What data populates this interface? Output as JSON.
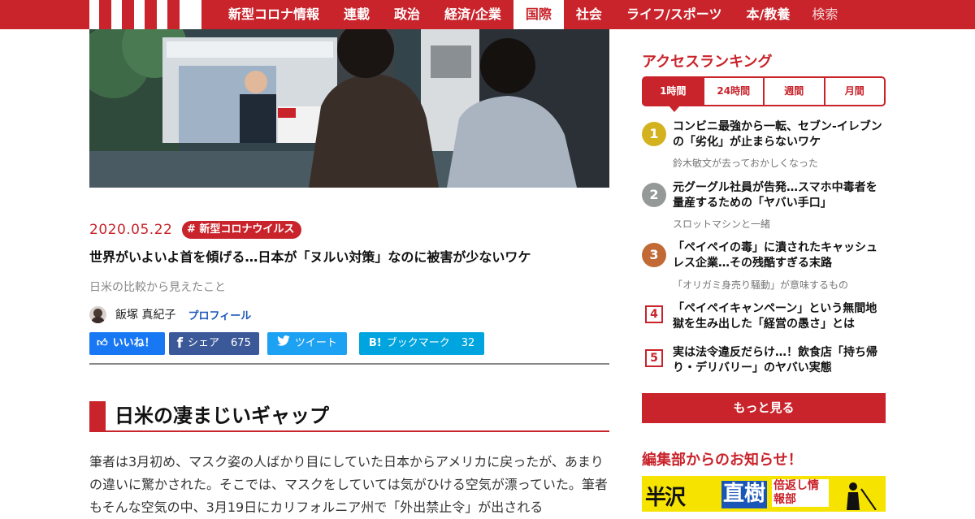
{
  "nav": {
    "items": [
      {
        "label": "新型コロナ情報",
        "active": false
      },
      {
        "label": "連載",
        "active": false
      },
      {
        "label": "政治",
        "active": false
      },
      {
        "label": "経済/企業",
        "active": false
      },
      {
        "label": "国際",
        "active": true
      },
      {
        "label": "社会",
        "active": false
      },
      {
        "label": "ライフ/スポーツ",
        "active": false
      },
      {
        "label": "本/教養",
        "active": false
      }
    ],
    "search_label": "検索"
  },
  "article": {
    "date": "2020.05.22",
    "tag": "# 新型コロナウイルス",
    "title": "世界がいよいよ首を傾げる…日本が「ヌルい対策」なのに被害が少ないワケ",
    "subtitle": "日米の比較から見えたこと",
    "author_name": "飯塚 真紀子",
    "profile_label": "プロフィール",
    "share": {
      "like_label": "いいね！",
      "facebook_label": "シェア",
      "facebook_count": "675",
      "twitter_label": "ツイート",
      "hatena_label": "ブックマーク",
      "hatena_count": "32"
    },
    "heading": "日米の凄まじいギャップ",
    "body": "筆者は3月初め、マスク姿の人ばかり目にしていた日本からアメリカに戻ったが、あまりの違いに驚かされた。そこでは、マスクをしていては気がひける空気が漂っていた。筆者もそんな空気の中、3月19日にカリフォルニア州で「外出禁止令」が出される"
  },
  "ranking": {
    "title": "アクセスランキング",
    "tabs": [
      "1時間",
      "24時間",
      "週間",
      "月間"
    ],
    "active_tab": 0,
    "items": [
      {
        "rank": "1",
        "title": "コンビニ最強から一転、セブン-イレブンの「劣化」が止まらないワケ",
        "sub": "鈴木敏文が去っておかしくなった",
        "badge_color": "#d4b21f"
      },
      {
        "rank": "2",
        "title": "元グーグル社員が告発…スマホ中毒者を量産するための「ヤバい手口」",
        "sub": "スロットマシンと一緒",
        "badge_color": "#959a98"
      },
      {
        "rank": "3",
        "title": "「ペイペイの毒」に潰されたキャッシュレス企業…その残酷すぎる末路",
        "sub": "「オリガミ身売り騒動」が意味するもの",
        "badge_color": "#c16a35"
      },
      {
        "rank": "4",
        "title": "「ペイペイキャンペーン」という無間地獄を生み出した「経営の愚さ」とは",
        "sub": ""
      },
      {
        "rank": "5",
        "title": "実は法令違反だらけ…！飲食店「持ち帰り・デリバリー」のヤバい実態",
        "sub": ""
      }
    ],
    "more_label": "もっと見る"
  },
  "notice": {
    "title": "編集部からのお知らせ！",
    "banner": {
      "line1": "半沢",
      "line2": "直樹",
      "line3": "倍返し情報部"
    }
  },
  "colors": {
    "brand": "#c9232b",
    "link": "#1a56b8"
  }
}
